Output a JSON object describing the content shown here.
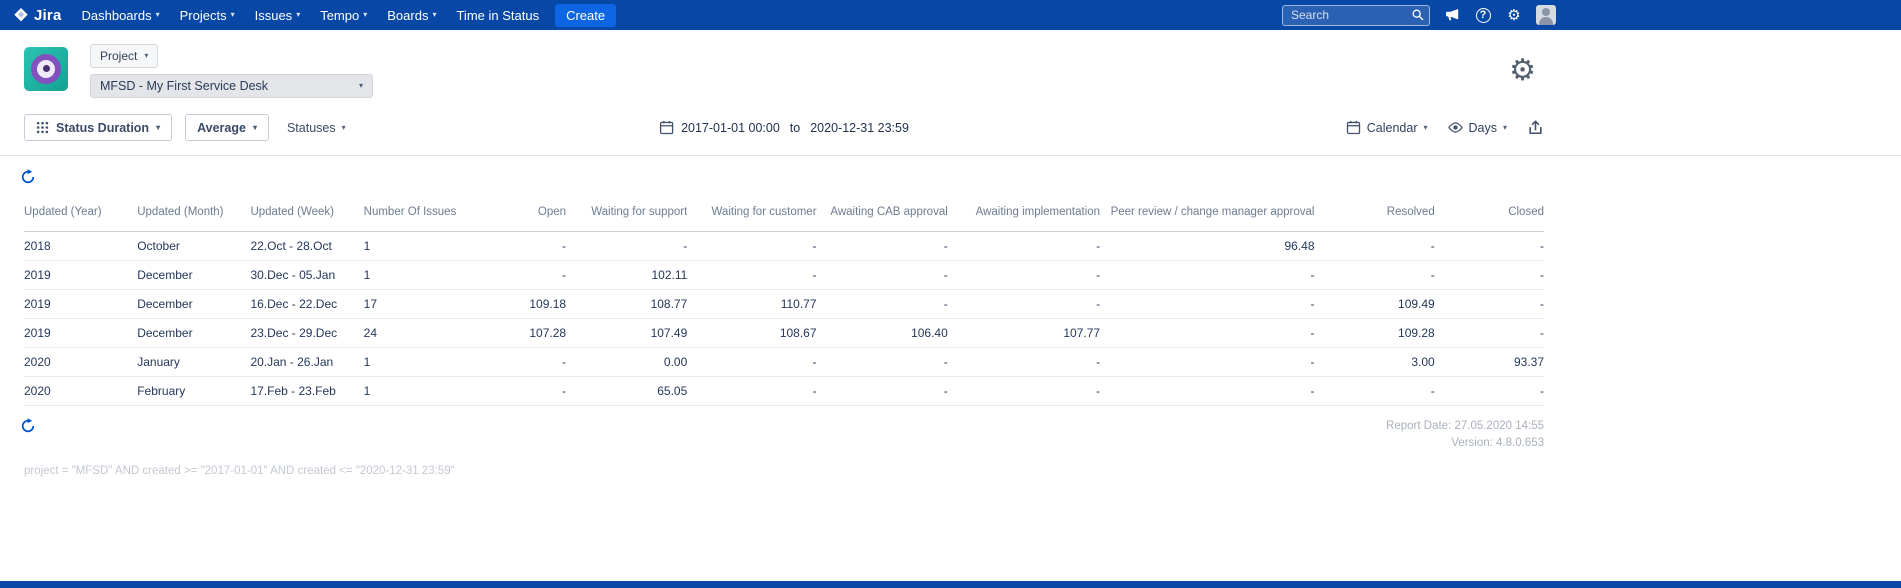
{
  "colors": {
    "navbar_blue": "#0747a6",
    "create_blue": "#0c66e4",
    "accent_blue": "#0052cc"
  },
  "icons": {
    "chevron_down": "▾",
    "gear": "⚙",
    "help": "?"
  },
  "navbar": {
    "logo_text": "Jira",
    "menu": [
      {
        "label": "Dashboards"
      },
      {
        "label": "Projects"
      },
      {
        "label": "Issues"
      },
      {
        "label": "Tempo"
      },
      {
        "label": "Boards"
      },
      {
        "label": "Time in Status"
      }
    ],
    "create_label": "Create",
    "search_placeholder": "Search"
  },
  "project_bar": {
    "type_label": "Project",
    "selected_project": "MFSD - My First Service Desk"
  },
  "toolbar": {
    "report_type": "Status Duration",
    "metric": "Average",
    "statuses": "Statuses",
    "date_from": "2017-01-01 00:00",
    "to_word": "to",
    "date_to": "2020-12-31 23:59",
    "calendar": "Calendar",
    "unit": "Days"
  },
  "table": {
    "columns": [
      "Updated (Year)",
      "Updated (Month)",
      "Updated (Week)",
      "Number Of Issues",
      "Open",
      "Waiting for support",
      "Waiting for customer",
      "Awaiting CAB approval",
      "Awaiting implementation",
      "Peer review / change manager approval",
      "Resolved",
      "Closed"
    ],
    "rows": [
      [
        "2018",
        "October",
        "22.Oct - 28.Oct",
        "1",
        "-",
        "-",
        "-",
        "-",
        "-",
        "96.48",
        "-",
        "-"
      ],
      [
        "2019",
        "December",
        "30.Dec - 05.Jan",
        "1",
        "-",
        "102.11",
        "-",
        "-",
        "-",
        "-",
        "-",
        "-"
      ],
      [
        "2019",
        "December",
        "16.Dec - 22.Dec",
        "17",
        "109.18",
        "108.77",
        "110.77",
        "-",
        "-",
        "-",
        "109.49",
        "-"
      ],
      [
        "2019",
        "December",
        "23.Dec - 29.Dec",
        "24",
        "107.28",
        "107.49",
        "108.67",
        "106.40",
        "107.77",
        "-",
        "109.28",
        "-"
      ],
      [
        "2020",
        "January",
        "20.Jan - 26.Jan",
        "1",
        "-",
        "0.00",
        "-",
        "-",
        "-",
        "-",
        "3.00",
        "93.37"
      ],
      [
        "2020",
        "February",
        "17.Feb - 23.Feb",
        "1",
        "-",
        "65.05",
        "-",
        "-",
        "-",
        "-",
        "-",
        "-"
      ]
    ]
  },
  "footer": {
    "report_date": "Report Date: 27.05.2020 14:55",
    "version": "Version: 4.8.0.653",
    "query": "project = \"MFSD\" AND created >= \"2017-01-01\" AND created <= \"2020-12-31 23:59\""
  }
}
